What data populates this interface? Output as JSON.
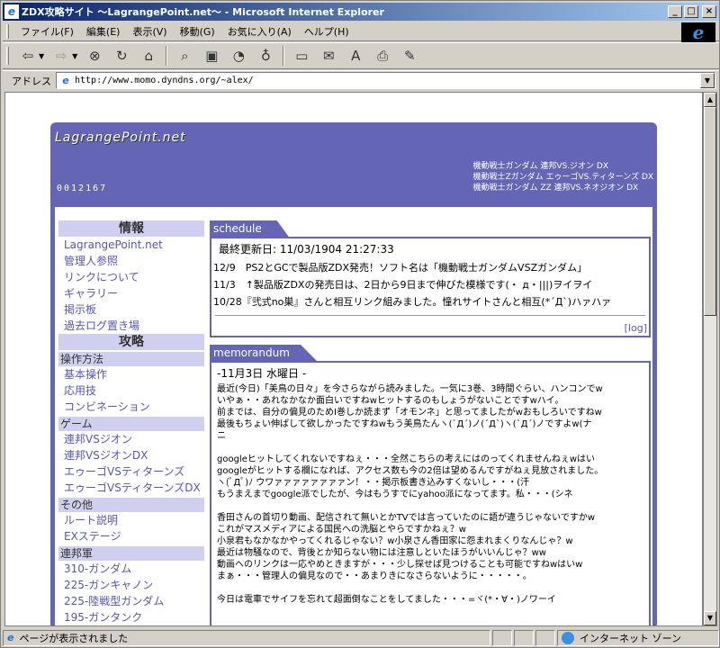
{
  "window": {
    "title": "ZDX攻略サイト 〜LagrangePoint.net〜 - Microsoft Internet Explorer",
    "minimize": "_",
    "maximize": "□",
    "close": "×"
  },
  "menubar": {
    "items": [
      "ファイル(F)",
      "編集(E)",
      "表示(V)",
      "移動(G)",
      "お気に入り(A)",
      "ヘルプ(H)"
    ]
  },
  "toolbar": {
    "buttons": [
      "back-icon",
      "forward-icon",
      "stop-icon",
      "refresh-icon",
      "home-icon",
      "search-icon",
      "favorites-icon",
      "history-icon",
      "channels-icon",
      "fullscreen-icon",
      "mail-icon",
      "font-icon",
      "print-icon",
      "edit-icon"
    ]
  },
  "address": {
    "label": "アドレス",
    "url": "http://www.momo.dyndns.org/~alex/"
  },
  "site": {
    "logo": "LagrangePoint.net",
    "counter": "0012167",
    "header_links": [
      "機動戦士ガンダム 連邦VS.ジオン DX",
      "機動戦士Zガンダム エゥーゴVS.ティターンズ DX",
      "機動戦士ガンダム ZZ 連邦VS.ネオジオン DX"
    ]
  },
  "sidebar": {
    "info_heading": "情報",
    "info_links": [
      "LagrangePoint.net",
      "管理人参照",
      "リンクについて",
      "ギャラリー",
      "掲示板",
      "過去ログ置き場"
    ],
    "strategy_heading": "攻略",
    "ops_heading": "操作方法",
    "ops_links": [
      "基本操作",
      "応用技",
      "コンビネーション"
    ],
    "game_heading": "ゲーム",
    "game_links": [
      "連邦VSジオン",
      "連邦VSジオンDX",
      "エゥーゴVSティターンズ",
      "エゥーゴVSティターンズDX"
    ],
    "other_heading": "その他",
    "other_links": [
      "ルート説明",
      "EXステージ"
    ],
    "federation_heading": "連邦軍",
    "federation_links": [
      "310-ガンダム",
      "225-ガンキャノン",
      "225-陸戦型ガンダム",
      "195-ガンタンク"
    ]
  },
  "schedule": {
    "tab": "schedule",
    "updated": "最終更新日: 11/03/1904 21:27:33",
    "rows": [
      "12/9　PS2とGCで製品版ZDX発売！ソフト名は「機動戦士ガンダムVSZガンダム」",
      "11/3　↑製品版ZDXの発売日は、2日から9日まで伸びた模様です(・ д・|||)ヲイヲイ",
      "10/28『弐式no巣』さんと相互リンク組みました。憧れサイトさんと相互(*´Д`)ハァハァ"
    ],
    "log": "[log]"
  },
  "memorandum": {
    "tab": "memorandum",
    "date": "-11月3日 水曜日 -",
    "paragraphs": [
      [
        "最近(今日)「美鳥の日々」を今さらながら読みました。一気に3巻、3時間ぐらい、ハンコンでw",
        "いやぁ・・あれなかなか面白いですねwヒットするのもしょうがないことですwハイ。",
        "前までは、自分の偏見のためI巻しか読まず「オモンネ」と思ってましたがwおもしろいですねw",
        "最後もちょい伸ばして欲しかったですねwもう美鳥たんヽ(`Д´)ノ(´Д`)ヽ(`Д´)ノですよw(ナ",
        "ニ"
      ],
      [
        "googleヒットしてくれないですねぇ・・・全然こちらの考えにはのってくれませんねぇwはい",
        "googleがヒットする欄になれば、アクセス数も今の2倍は望めるんですがねぇ見放されました。",
        "ヽ(ﾟДﾟ)ﾉ ウワァァァァァァァァン！・・掲示板書き込みすくないし・・・(汗",
        "もうまえまでgoogle派でしたが、今はもうすでにyahoo派になってます。私・・・(シネ"
      ],
      [
        "香田さんの首切り動画、配信されて無いとかTVでは言っていたのに語が違うじゃないですかw",
        "これがマスメディアによる国民への洗脳とやらですかねぇ？w",
        "小泉君もなかなかやってくれるじゃない？w小泉さん香田家に怨まれまくりなんじゃ？w",
        "最近は物騒なので、背後とか知らない物には注意しといたほうがいいんじゃ？ww",
        "動画へのリンクは一応やめときますが・・・少し探せば見つけることも可能ですねwはいw",
        "まぁ・・・管理人の偏見なので・・あまりきになさらないように・・・・・。"
      ],
      [
        "今日は電車でサイフを忘れて超面倒なことをしてました・・・=ヾ(*・∀・)ノワーイ"
      ]
    ]
  },
  "status": {
    "text": "ページが表示されました",
    "zone": "インターネット ゾーン"
  }
}
